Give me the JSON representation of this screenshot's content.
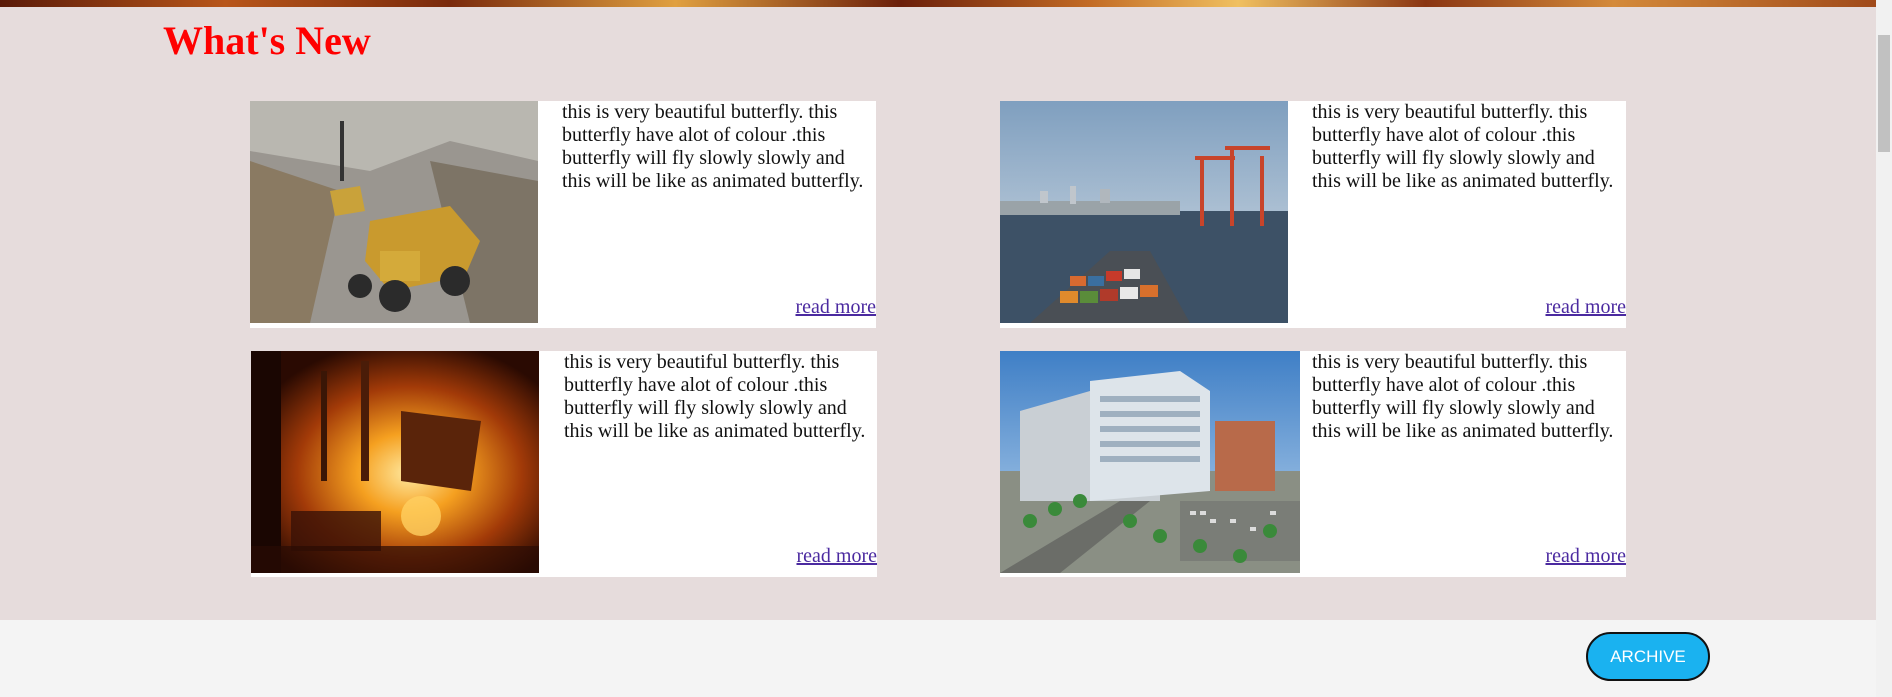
{
  "section": {
    "title": "What's New"
  },
  "cards": [
    {
      "text": "this is very beautiful butterfly. this butterfly have alot of colour .this butterfly will fly slowly slowly and this will be like as animated butterfly.",
      "link": "read more",
      "image": "mining-dump-truck-photo"
    },
    {
      "text": "this is very beautiful butterfly. this butterfly have alot of colour .this butterfly will fly slowly slowly and this will be like as animated butterfly.",
      "link": "read more",
      "image": "container-port-photo"
    },
    {
      "text": "this is very beautiful butterfly. this butterfly have alot of colour .this butterfly will fly slowly slowly and this will be like as animated butterfly.",
      "link": "read more",
      "image": "steel-furnace-photo"
    },
    {
      "text": "this is very beautiful butterfly. this butterfly have alot of colour .this butterfly will fly slowly slowly and this will be like as animated butterfly.",
      "link": "read more",
      "image": "office-building-photo"
    }
  ],
  "footer": {
    "archive_label": "ARCHIVE"
  },
  "colors": {
    "title": "#ff0000",
    "section_bg": "#e6dcdc",
    "archive_button": "#1ab2f0",
    "link": "#4b2aa0"
  }
}
